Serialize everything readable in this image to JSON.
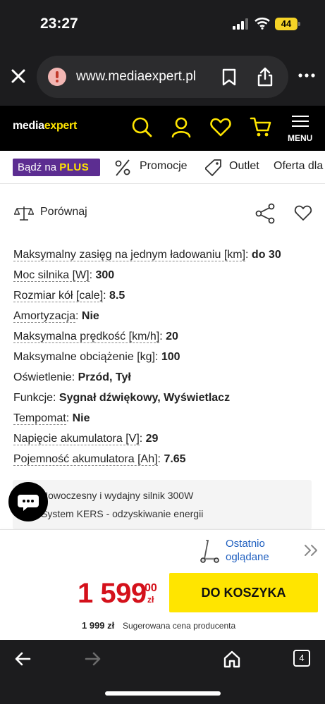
{
  "status": {
    "time": "23:27",
    "battery": "44"
  },
  "browser": {
    "url": "www.mediaexpert.pl",
    "icons": [
      "close-icon",
      "site-alert-icon",
      "bookmark-icon",
      "share-icon",
      "more-icon"
    ]
  },
  "site": {
    "logo_white": "media",
    "logo_yellow": "expert",
    "menu_label": "MENU",
    "icons": [
      "search-icon",
      "account-icon",
      "wishlist-icon",
      "cart-icon",
      "menu-icon"
    ]
  },
  "categories": {
    "plus_prefix": "Bądź na ",
    "plus_brand": "PLUS",
    "items": [
      "Promocje",
      "Outlet",
      "Oferta dla"
    ]
  },
  "product": {
    "compare_label": "Porównaj",
    "specs": [
      {
        "key": "Maksymalny zasięg na jednym ładowaniu [km]",
        "value": "do 30"
      },
      {
        "key": "Moc silnika [W]",
        "value": "300"
      },
      {
        "key": "Rozmiar kół [cale]",
        "value": "8.5"
      },
      {
        "key": "Amortyzacja",
        "value": "Nie"
      },
      {
        "key": "Maksymalna prędkość [km/h]",
        "value": "20"
      },
      {
        "key": "Maksymalne obciążenie [kg]",
        "value": "100"
      },
      {
        "key": "Oświetlenie",
        "value": "Przód, Tył"
      },
      {
        "key": "Funkcje",
        "value": "Sygnał dźwiękowy, Wyświetlacz"
      },
      {
        "key": "Tempomat",
        "value": "Nie"
      },
      {
        "key": "Napięcie akumulatora [V]",
        "value": "29"
      },
      {
        "key": "Pojemność akumulatora [Ah]",
        "value": "7.65"
      }
    ],
    "features": [
      "Nowoczesny i wydajny silnik 300W",
      "System KERS - odzyskiwanie energii"
    ]
  },
  "recent": {
    "line1": "Ostatnio",
    "line2": "oglądane"
  },
  "price": {
    "main": "1 599",
    "cents": "00",
    "currency": "zł",
    "cart_button": "DO KOSZYKA",
    "old_price": "1 999 zł",
    "old_note": "Sugerowana cena producenta"
  },
  "bottomnav": {
    "tab_count": "4"
  },
  "colors": {
    "brand_yellow": "#ffe500",
    "price_red": "#d4111b",
    "plus_purple": "#5c2d91",
    "link_blue": "#1f5fbf"
  }
}
